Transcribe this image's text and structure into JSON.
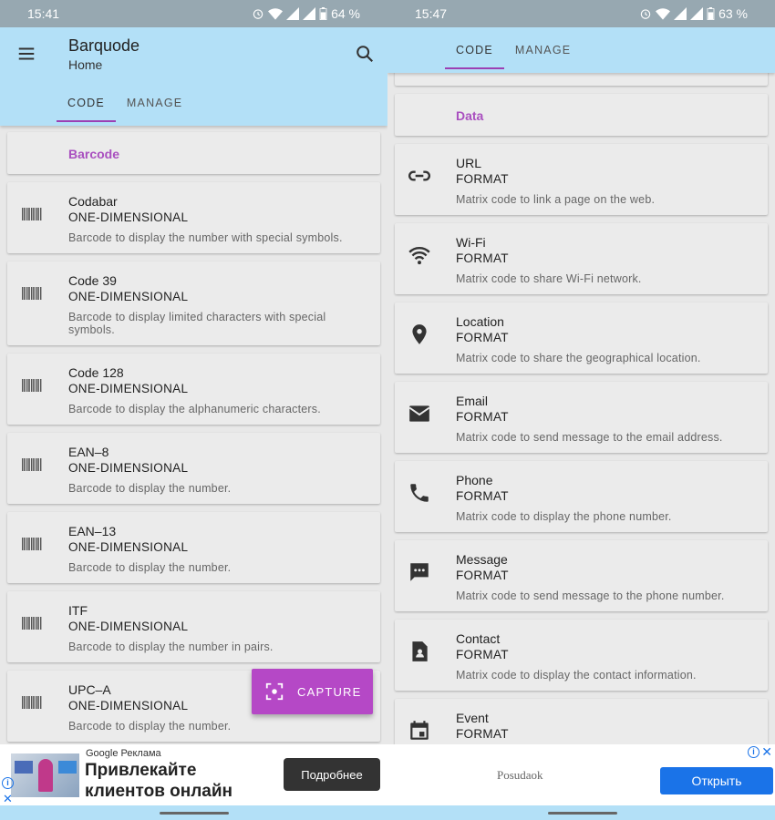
{
  "left": {
    "status": {
      "time": "15:41",
      "battery": "64 %"
    },
    "appbar": {
      "title": "Barquode",
      "subtitle": "Home"
    },
    "tabs": [
      {
        "label": "CODE"
      },
      {
        "label": "MANAGE"
      }
    ],
    "section": {
      "label": "Barcode"
    },
    "items": [
      {
        "title": "Codabar",
        "format": "ONE-DIMENSIONAL",
        "desc": "Barcode to display the number with special symbols."
      },
      {
        "title": "Code 39",
        "format": "ONE-DIMENSIONAL",
        "desc": "Barcode to display limited characters with special symbols."
      },
      {
        "title": "Code 128",
        "format": "ONE-DIMENSIONAL",
        "desc": "Barcode to display the alphanumeric characters."
      },
      {
        "title": "EAN–8",
        "format": "ONE-DIMENSIONAL",
        "desc": "Barcode to display the number."
      },
      {
        "title": "EAN–13",
        "format": "ONE-DIMENSIONAL",
        "desc": "Barcode to display the number."
      },
      {
        "title": "ITF",
        "format": "ONE-DIMENSIONAL",
        "desc": "Barcode to display the number in pairs."
      },
      {
        "title": "UPC–A",
        "format": "ONE-DIMENSIONAL",
        "desc": "Barcode to display the number."
      }
    ],
    "fab": {
      "label": "CAPTURE"
    },
    "ad": {
      "label": "Google Реклама",
      "headline_line1": "Привлекайте",
      "headline_line2": "клиентов онлайн",
      "button": "Подробнее"
    }
  },
  "right": {
    "status": {
      "time": "15:47",
      "battery": "63 %"
    },
    "tabs": [
      {
        "label": "CODE"
      },
      {
        "label": "MANAGE"
      }
    ],
    "section": {
      "label": "Data"
    },
    "items": [
      {
        "title": "URL",
        "format": "FORMAT",
        "desc": "Matrix code to link a page on the web.",
        "icon": "link-icon"
      },
      {
        "title": "Wi-Fi",
        "format": "FORMAT",
        "desc": "Matrix code to share Wi-Fi network.",
        "icon": "wifi-icon"
      },
      {
        "title": "Location",
        "format": "FORMAT",
        "desc": "Matrix code to share the geographical location.",
        "icon": "location-pin-icon"
      },
      {
        "title": "Email",
        "format": "FORMAT",
        "desc": "Matrix code to send message to the email address.",
        "icon": "email-icon"
      },
      {
        "title": "Phone",
        "format": "FORMAT",
        "desc": "Matrix code to display the phone number.",
        "icon": "phone-icon"
      },
      {
        "title": "Message",
        "format": "FORMAT",
        "desc": "Matrix code to send message to the phone number.",
        "icon": "message-icon"
      },
      {
        "title": "Contact",
        "format": "FORMAT",
        "desc": "Matrix code to display the contact information.",
        "icon": "contact-icon"
      },
      {
        "title": "Event",
        "format": "FORMAT",
        "desc": "",
        "icon": "calendar-icon"
      }
    ],
    "ad": {
      "brand": "Posudaok",
      "button": "Открыть"
    }
  }
}
